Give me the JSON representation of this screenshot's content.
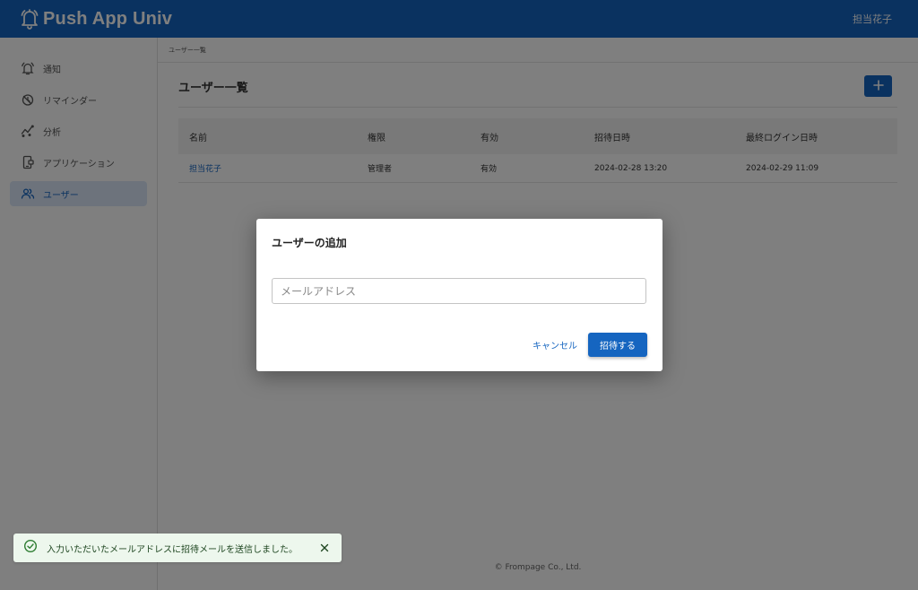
{
  "header": {
    "brand": "Push App Univ",
    "user_name": "担当花子"
  },
  "sidebar": {
    "items": [
      {
        "label": "通知",
        "icon": "bell-icon"
      },
      {
        "label": "リマインダー",
        "icon": "timer-icon"
      },
      {
        "label": "分析",
        "icon": "chart-icon"
      },
      {
        "label": "アプリケーション",
        "icon": "phone-app-icon"
      },
      {
        "label": "ユーザー",
        "icon": "users-icon",
        "active": true
      }
    ]
  },
  "main": {
    "breadcrumb": "ユーザー一覧",
    "title": "ユーザー一覧",
    "table": {
      "headers": [
        "名前",
        "権限",
        "有効",
        "招待日時",
        "最終ログイン日時"
      ],
      "rows": [
        [
          "担当花子",
          "管理者",
          "有効",
          "2024-02-28 13:20",
          "2024-02-29 11:09"
        ]
      ]
    },
    "footer": "© Frompage Co., Ltd."
  },
  "dialog": {
    "title": "ユーザーの追加",
    "email_placeholder": "メールアドレス",
    "email_value": "",
    "cancel_label": "キャンセル",
    "submit_label": "招待する"
  },
  "snackbar": {
    "message": "入力いただいたメールアドレスに招待メールを送信しました。",
    "severity": "success"
  },
  "colors": {
    "primary": "#1565c0",
    "success_bg": "#edf7ed",
    "success_icon": "#2e7d32",
    "overlay": "rgba(0,0,0,0.5)"
  }
}
